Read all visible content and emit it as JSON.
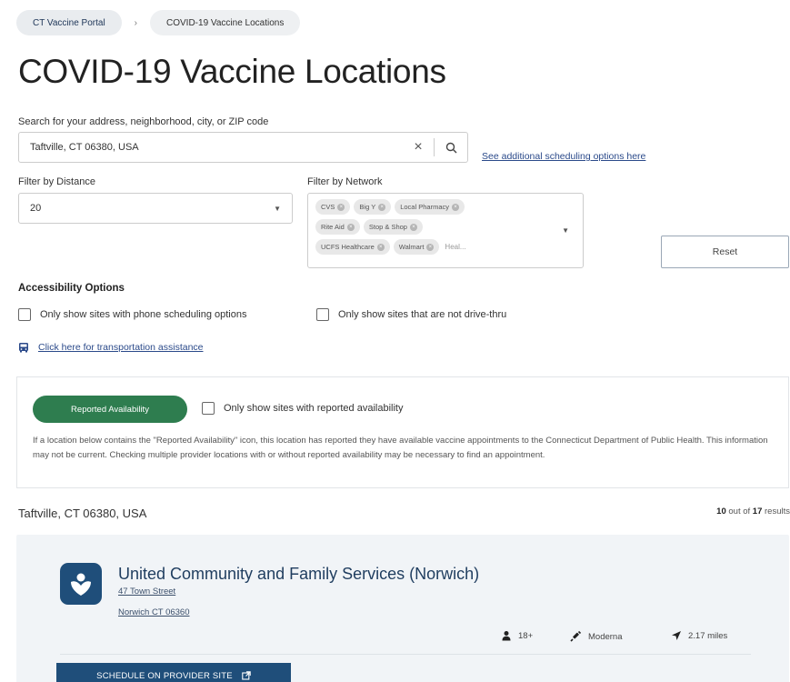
{
  "breadcrumb": {
    "items": [
      "CT Vaccine Portal",
      "COVID-19 Vaccine Locations"
    ],
    "separator": "›"
  },
  "page": {
    "title": "COVID-19 Vaccine Locations"
  },
  "search": {
    "label": "Search for your address, neighborhood, city, or ZIP code",
    "value": "Taftville, CT 06380, USA",
    "clear_icon": "×",
    "scheduling_link": "See additional scheduling options here"
  },
  "distance": {
    "label": "Filter by Distance",
    "value": "20",
    "caret": "▼"
  },
  "network": {
    "label": "Filter by Network",
    "rows": [
      [
        "CVS",
        "Big Y",
        "Local Pharmacy"
      ],
      [
        "Rite Aid",
        "Stop & Shop"
      ],
      [
        "UCFS Healthcare",
        "Walmart"
      ]
    ],
    "placeholder": "Heal...",
    "chip_remove_icon": "×",
    "caret": "▼"
  },
  "reset_label": "Reset",
  "accessibility": {
    "title": "Accessibility Options",
    "phone_option": "Only show sites with phone scheduling options",
    "drive_option": "Only show sites that are not drive-thru",
    "transport_link": "Click here for transportation assistance"
  },
  "availability": {
    "badge": "Reported Availability",
    "check_label": "Only show sites with reported availability",
    "description": "If a location below contains the \"Reported Availability\" icon, this location has reported they have available vaccine appointments to the Connecticut Department of Public Health. This information may not be current. Checking multiple provider locations with or without reported availability may be necessary to find an appointment."
  },
  "results": {
    "location": "Taftville, CT 06380, USA",
    "count_shown": "10",
    "count_mid": "out of",
    "count_total": "17",
    "count_suffix": "results"
  },
  "card": {
    "title": "United Community and Family Services (Norwich)",
    "street": "47 Town Street",
    "city": "Norwich CT 06360",
    "age": "18+",
    "vaccine": "Moderna",
    "distance": "2.17 miles",
    "button": "SCHEDULE ON PROVIDER SITE"
  },
  "colors": {
    "primary": "#1f4e7a",
    "availability_green": "#2e7d4f",
    "link": "#2b4a8a",
    "card_bg": "#f1f4f7"
  },
  "icons": [
    "search-icon",
    "close-icon",
    "chevron-down-icon",
    "bus-icon",
    "heart-hands-icon",
    "person-icon",
    "syringe-icon",
    "location-arrow-icon",
    "external-link-icon"
  ]
}
